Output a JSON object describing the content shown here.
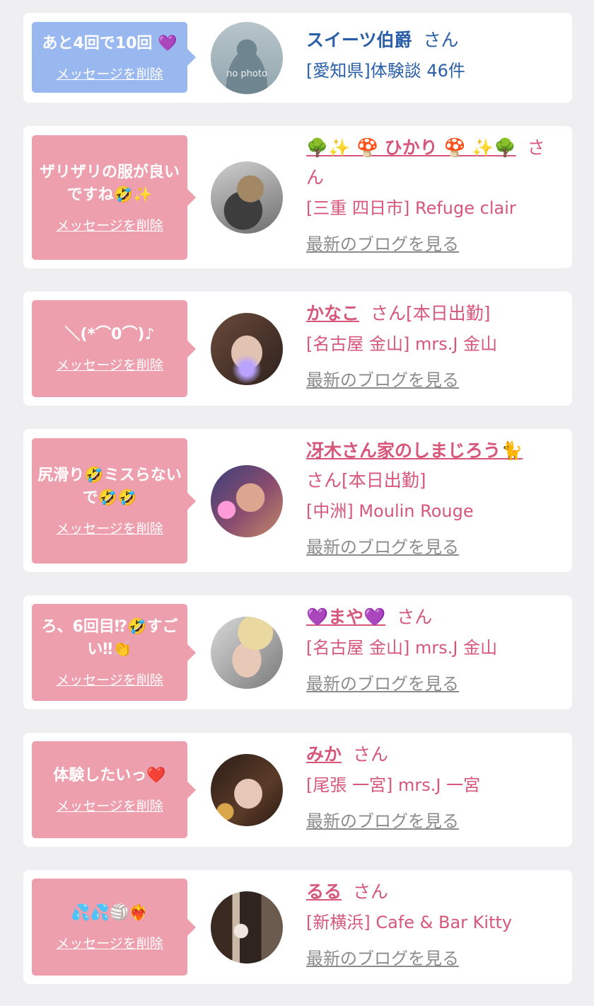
{
  "delete_label": "メッセージを削除",
  "blog_label": "最新のブログを見る",
  "entries": [
    {
      "message": "あと4回で10回 💜",
      "name": "スイーツ伯爵",
      "suffix": "さん",
      "info": "[愛知県]体験談 46件",
      "avatar_text": "no photo"
    },
    {
      "message": "ザリザリの服が良いですね🤣✨",
      "name": "🌳✨ 🍄 ひかり 🍄 ✨🌳",
      "suffix": "さん",
      "info": "[三重 四日市] Refuge clair"
    },
    {
      "message": "＼(*⌒0⌒)♪",
      "name": "かなこ",
      "suffix": "さん[本日出勤]",
      "info": "[名古屋 金山] mrs.J 金山"
    },
    {
      "message": "尻滑り🤣ミスらないで🤣🤣",
      "name": "冴木さん家のしまじろう🐈",
      "suffix": "さん[本日出勤]",
      "info": "[中洲] Moulin Rouge"
    },
    {
      "message": "ろ、6回目⁉🤣すごい‼👏",
      "name": "💜まや💜",
      "suffix": "さん",
      "info": "[名古屋 金山] mrs.J 金山"
    },
    {
      "message": "体験したいっ❤️",
      "name": "みか",
      "suffix": "さん",
      "info": "[尾張 一宮] mrs.J 一宮"
    },
    {
      "message": "💦💦🏐❤️‍🔥",
      "name": "るる",
      "suffix": "さん",
      "info": "[新横浜] Cafe & Bar Kitty"
    }
  ]
}
